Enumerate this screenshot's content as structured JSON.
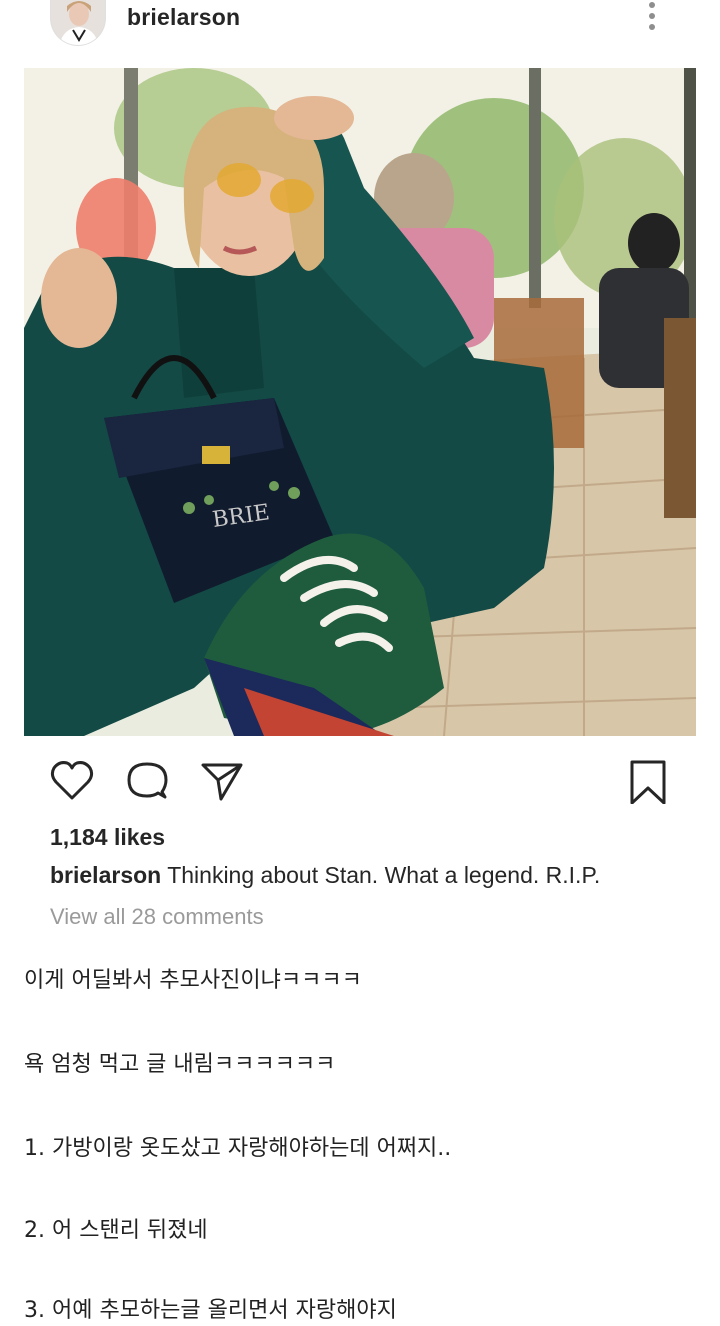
{
  "post": {
    "username": "brielarson",
    "likes": "1,184 likes",
    "caption_user": "brielarson",
    "caption_text": "Thinking about Stan. What a legend. R.I.P.",
    "view_comments": "View all 28 comments",
    "bag_text": "BRIE"
  },
  "icons": {
    "more": "more-vertical-icon",
    "like": "heart-icon",
    "comment": "comment-icon",
    "share": "send-icon",
    "save": "bookmark-icon"
  },
  "body_text": [
    "이게 어딜봐서 추모사진이냐ㅋㅋㅋㅋ",
    "욕 엄청 먹고 글 내림ㅋㅋㅋㅋㅋㅋ",
    "1. 가방이랑 옷도샀고 자랑해야하는데 어쩌지..",
    "2. 어 스탠리 뒤졌네",
    "3. 어예 추모하는글 올리면서 자랑해야지"
  ]
}
